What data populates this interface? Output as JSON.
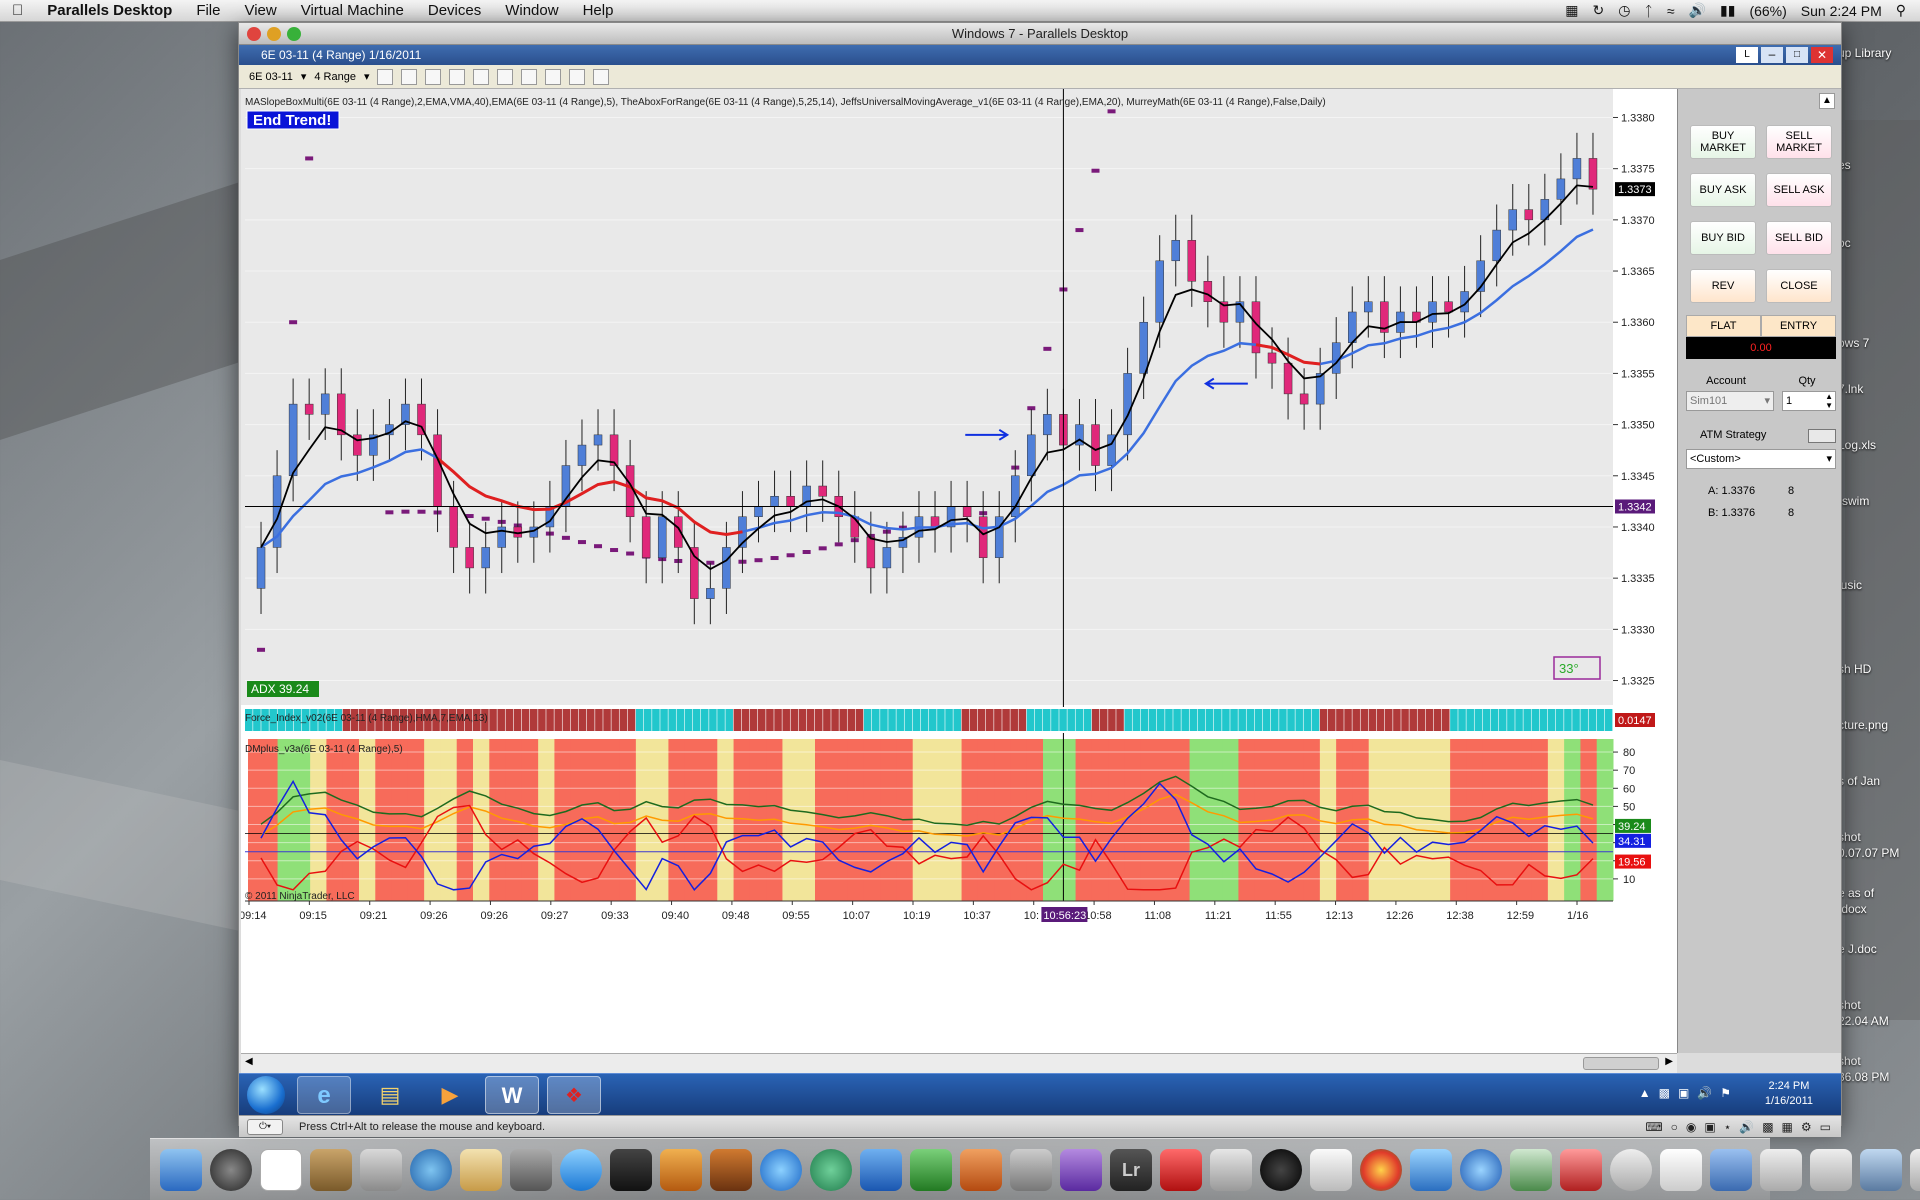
{
  "menubar": {
    "app": "Parallels Desktop",
    "items": [
      "File",
      "View",
      "Virtual Machine",
      "Devices",
      "Window",
      "Help"
    ],
    "battery": "(66%)",
    "clock": "Sun 2:24 PM"
  },
  "desktop_labels": [
    "up Library",
    "es",
    "oc",
    "ows 7",
    "7.lnk",
    "Log.xls",
    "rswim",
    "lusic",
    "sh HD",
    "cture.png",
    "s of Jan",
    "shot",
    "0.07.07 PM",
    "e as of",
    ".docx",
    "e J.doc",
    "shot",
    "22.04 AM",
    "shot",
    "36.08 PM"
  ],
  "parallels": {
    "title": "Windows 7 - Parallels Desktop",
    "status_text": "Press Ctrl+Alt to release the mouse and keyboard."
  },
  "ninja": {
    "title": "6E 03-11 (4 Range)  1/16/2011",
    "instrument": "6E 03-11",
    "interval": "4 Range",
    "indicator_line": "MASlopeBoxMulti(6E 03-11 (4 Range),2,EMA,VMA,40),EMA(6E 03-11 (4 Range),5), TheAboxForRange(6E 03-11 (4 Range),5,25,14), JeffsUniversalMovingAverage_v1(6E 03-11 (4 Range),EMA,20), MurreyMath(6E 03-11 (4 Range),False,Daily)",
    "end_trend": "End Trend!",
    "adx_label": "ADX 39.24",
    "angle_label": "33°",
    "force_label": "Force_Index_v02(6E 03-11 (4 Range),HMA,7,EMA,13)",
    "dm_label": "DMplus_v3a(6E 03-11 (4 Range),5)",
    "copyright": "© 2011 NinjaTrader, LLC",
    "cursor_time": "10:56:23"
  },
  "chart_data": [
    {
      "type": "candlestick",
      "ylim": [
        1.3323,
        1.3382
      ],
      "yticks": [
        "1.3380",
        "1.3375",
        "1.3370",
        "1.3365",
        "1.3360",
        "1.3355",
        "1.3350",
        "1.3345",
        "1.3340",
        "1.3335",
        "1.3330",
        "1.3325"
      ],
      "current_price": "1.3373",
      "cursor_price": "1.3342",
      "xticks": [
        "09:14",
        "09:15",
        "09:21",
        "09:26",
        "09:26",
        "09:27",
        "09:33",
        "09:40",
        "09:48",
        "09:55",
        "10:07",
        "10:19",
        "10:37",
        "10:",
        "10:58",
        "11:08",
        "11:21",
        "11:55",
        "12:13",
        "12:26",
        "12:38",
        "12:59",
        "1/16"
      ],
      "closes": [
        1.3338,
        1.3345,
        1.3352,
        1.3351,
        1.3353,
        1.3349,
        1.3347,
        1.3349,
        1.335,
        1.3352,
        1.3349,
        1.3342,
        1.3338,
        1.3336,
        1.3338,
        1.334,
        1.3339,
        1.334,
        1.3342,
        1.3346,
        1.3348,
        1.3349,
        1.3346,
        1.3341,
        1.3337,
        1.3341,
        1.3338,
        1.3333,
        1.3334,
        1.3338,
        1.3341,
        1.3342,
        1.3343,
        1.3342,
        1.3344,
        1.3343,
        1.3341,
        1.3339,
        1.3336,
        1.3338,
        1.3339,
        1.3341,
        1.334,
        1.3342,
        1.3341,
        1.3337,
        1.3341,
        1.3345,
        1.3349,
        1.3351,
        1.3348,
        1.335,
        1.3346,
        1.3349,
        1.3355,
        1.336,
        1.3366,
        1.3368,
        1.3364,
        1.3362,
        1.336,
        1.3362,
        1.3357,
        1.3356,
        1.3353,
        1.3352,
        1.3355,
        1.3358,
        1.3361,
        1.3362,
        1.3359,
        1.3361,
        1.336,
        1.3362,
        1.3361,
        1.3363,
        1.3366,
        1.3369,
        1.3371,
        1.337,
        1.3372,
        1.3374,
        1.3376,
        1.3373
      ],
      "series": [
        {
          "name": "EMA 5",
          "color": "#000000"
        },
        {
          "name": "EMA 20",
          "color": "#3b6fe0"
        },
        {
          "name": "MASlopeBox",
          "color": "#e02020"
        },
        {
          "name": "MurreyMath",
          "color": "#7a1a7a"
        }
      ]
    },
    {
      "type": "line",
      "yticks": [
        "80",
        "70",
        "60",
        "50",
        "40",
        "30",
        "20",
        "10"
      ],
      "ylim": [
        0,
        85
      ],
      "readouts": [
        "39.24",
        "34.31",
        "19.56"
      ],
      "force_value": "0.0147"
    }
  ],
  "sidepanel": {
    "buttons": [
      "BUY MARKET",
      "SELL MARKET",
      "BUY ASK",
      "SELL ASK",
      "BUY BID",
      "SELL BID",
      "REV",
      "CLOSE"
    ],
    "flat": "FLAT",
    "entry": "ENTRY",
    "pnl": "0.00",
    "account_label": "Account",
    "qty_label": "Qty",
    "account": "Sim101",
    "qty": "1",
    "atm_label": "ATM Strategy",
    "atm_value": "<Custom>",
    "ask": "A: 1.3376",
    "ask_size": "8",
    "bid": "B: 1.3376",
    "bid_size": "8"
  },
  "win_taskbar": {
    "time": "2:24 PM",
    "date": "1/16/2011"
  },
  "colors": {
    "bull": "#4f7fd8",
    "bear": "#e0287a",
    "zone_red": "#f76b5a",
    "zone_yellow": "#f2e59a",
    "zone_green": "#8fe078",
    "force_teal": "#22c7cc",
    "force_maroon": "#b03a3a"
  }
}
